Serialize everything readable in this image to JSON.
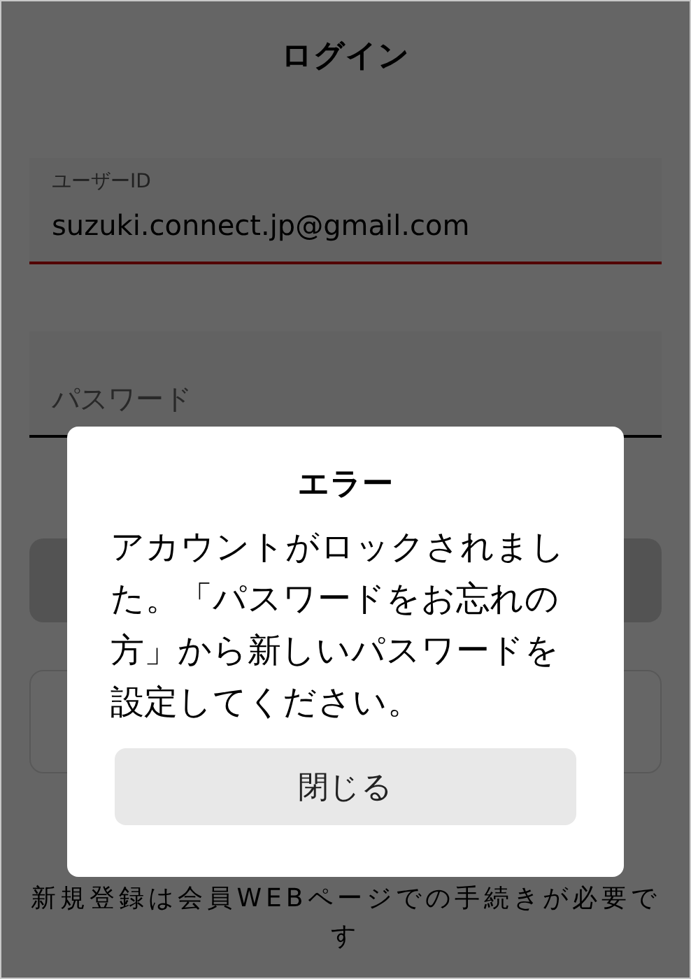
{
  "header": {
    "title": "ログイン"
  },
  "fields": [
    {
      "label": "ユーザーID",
      "value": "suzuki.connect.jp@gmail.com",
      "focused": true
    },
    {
      "placeholder": "パスワード",
      "focused": false
    }
  ],
  "note": "新規登録は会員WEBページでの手続きが必要です",
  "dialog": {
    "title": "エラー",
    "message": "アカウントがロックされました。「パスワードをお忘れの方」から新しいパスワードを設定してください。",
    "button": "閉じる"
  }
}
